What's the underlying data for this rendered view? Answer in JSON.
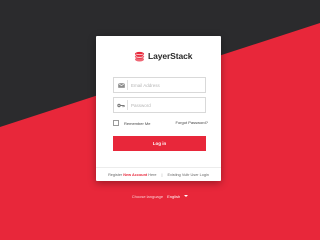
{
  "brand": {
    "name": "LayerStack",
    "logo_icon": "layerstack-logo-icon",
    "accent_color": "#e8273a",
    "dark_color": "#2b2b2d"
  },
  "form": {
    "email_placeholder": "Email Address",
    "email_value": "",
    "email_icon": "envelope-icon",
    "password_placeholder": "Password",
    "password_value": "",
    "password_icon": "key-icon",
    "remember_label": "Remember Me",
    "remember_checked": false,
    "forgot_label": "Forgot Password?",
    "login_label": "Log in"
  },
  "footer": {
    "register_prefix": "Register",
    "register_link": "New Account",
    "register_suffix": "Here",
    "divider": "|",
    "existing_user_label": "Existing Vultr User Login"
  },
  "language": {
    "label": "Choose language",
    "selected": "English"
  }
}
